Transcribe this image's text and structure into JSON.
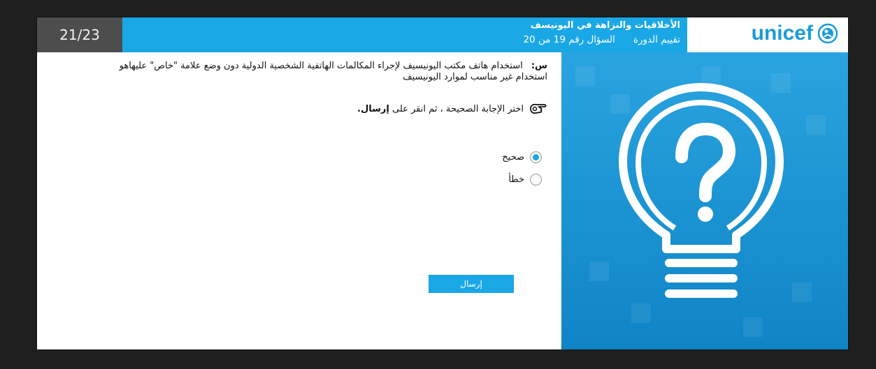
{
  "header": {
    "counter": "21/23",
    "title": "الأخلاقيات والنزاهة في اليونيسف",
    "course_assessment": "تقييم الدورة",
    "question_progress": "السؤال رقم 19 من 20",
    "logo_text": "unicef"
  },
  "question": {
    "prefix": "س:",
    "text": "استخدام هاتف مكتب اليونيسيف لإجراء المكالمات الهاتفية الشخصية الدولية دون وضع علامة \"خاص\" عليهاهو استخدام غير مناسب لموارد اليونيسيف"
  },
  "instruction": {
    "text": "اختر الإجابة الصحيحة ، ثم انقر على",
    "action": "إرسال."
  },
  "options": [
    {
      "label": "صحيح",
      "selected": true
    },
    {
      "label": "خطأ",
      "selected": false
    }
  ],
  "submit_label": "إرسال",
  "colors": {
    "accent": "#1aa7e6",
    "counter_bg": "#4d4d4d",
    "illustration_bg": "#1b9ad9"
  },
  "icons": {
    "instruction": "pointing-hand-icon",
    "illustration": "lightbulb-question-icon",
    "logo": "unicef-emblem-icon"
  }
}
